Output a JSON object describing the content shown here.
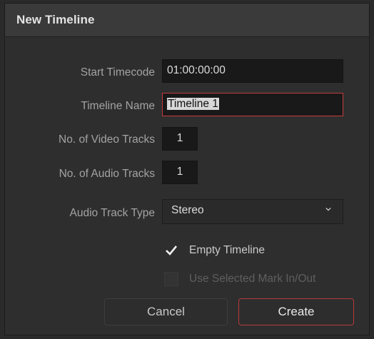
{
  "dialog": {
    "title": "New Timeline"
  },
  "form": {
    "start_timecode": {
      "label": "Start Timecode",
      "value": "01:00:00:00"
    },
    "timeline_name": {
      "label": "Timeline Name",
      "value": "Timeline 1"
    },
    "video_tracks": {
      "label": "No. of Video Tracks",
      "value": "1"
    },
    "audio_tracks": {
      "label": "No. of Audio Tracks",
      "value": "1"
    },
    "audio_track_type": {
      "label": "Audio Track Type",
      "selected": "Stereo",
      "icon": "chevron-down-icon"
    },
    "empty_timeline": {
      "label": "Empty Timeline",
      "checked": true
    },
    "use_selected_mark": {
      "label": "Use Selected Mark In/Out",
      "checked": false,
      "disabled": true
    }
  },
  "buttons": {
    "cancel": "Cancel",
    "create": "Create"
  },
  "colors": {
    "accent": "#c63c3c",
    "panel": "#2e2e2e",
    "titlebar": "#3a3a3a",
    "field": "#191919"
  }
}
